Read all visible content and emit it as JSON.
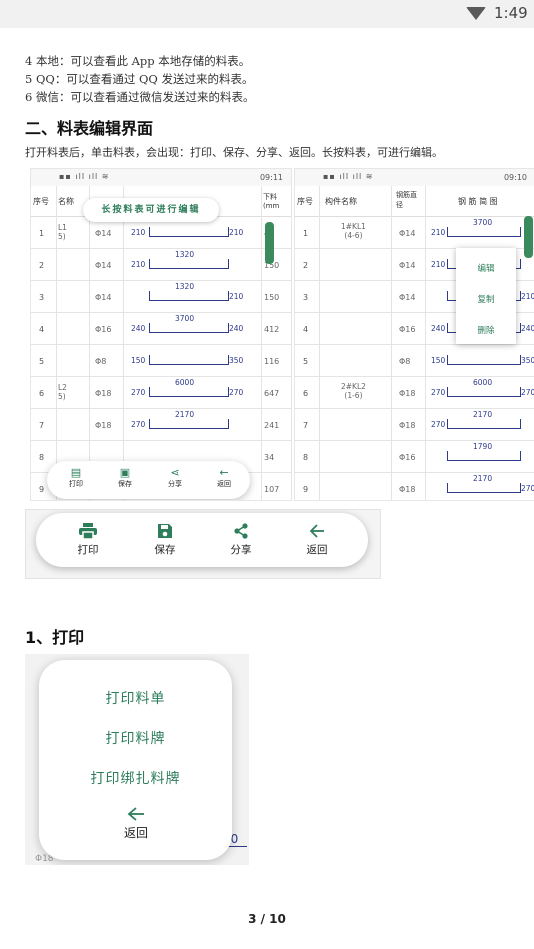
{
  "status_bar": {
    "time": "1:49"
  },
  "doc": {
    "lines": [
      "4 本地：可以查看此 App 本地存储的料表。",
      "5 QQ：可以查看通过 QQ 发送过来的料表。",
      "6 微信：可以查看通过微信发送过来的料表。"
    ],
    "section_title": "二、料表编辑界面",
    "section_desc": "打开料表后，单击料表，会出现：打印、保存、分享、返回。长按料表，可进行编辑。",
    "subsection_title": "1、打印",
    "page_number": "3  /  10"
  },
  "left_screen": {
    "status_time": "09:11",
    "headers": [
      "序号",
      "名称",
      "下料(mm"
    ],
    "tip": "长按料表可进行编辑",
    "rows": [
      {
        "n": "1",
        "name": "L1\n5)",
        "dia": "Φ14",
        "left": "210",
        "mid": "",
        "right": "210",
        "len": "4"
      },
      {
        "n": "2",
        "name": "",
        "dia": "Φ14",
        "left": "210",
        "mid": "1320",
        "right": "",
        "len": "150"
      },
      {
        "n": "3",
        "name": "",
        "dia": "Φ14",
        "left": "",
        "mid": "1320",
        "right": "210",
        "len": "150"
      },
      {
        "n": "4",
        "name": "",
        "dia": "Φ16",
        "left": "240",
        "mid": "3700",
        "right": "240",
        "len": "412"
      },
      {
        "n": "5",
        "name": "",
        "dia": "Φ8",
        "left": "150",
        "mid": "",
        "right": "350",
        "len": "116"
      },
      {
        "n": "6",
        "name": "L2\n5)",
        "dia": "Φ18",
        "left": "270",
        "mid": "6000",
        "right": "270",
        "len": "647"
      },
      {
        "n": "7",
        "name": "",
        "dia": "Φ18",
        "left": "270",
        "mid": "2170",
        "right": "",
        "len": "241"
      },
      {
        "n": "8",
        "name": "",
        "dia": "",
        "left": "",
        "mid": "",
        "right": "",
        "len": "34"
      },
      {
        "n": "9",
        "name": "",
        "dia": "",
        "left": "",
        "mid": "",
        "right": "",
        "len": "107"
      }
    ],
    "mini_actions": [
      "打印",
      "保存",
      "分享",
      "返回"
    ]
  },
  "right_screen": {
    "status_time": "09:10",
    "headers": [
      "序号",
      "构件名称",
      "钢筋直径",
      "钢 筋 简 图"
    ],
    "rows": [
      {
        "n": "1",
        "name": "1#KL1\n(4-6)",
        "dia": "Φ14",
        "left": "210",
        "mid": "3700",
        "right": ""
      },
      {
        "n": "2",
        "name": "",
        "dia": "Φ14",
        "left": "210",
        "mid": "",
        "right": ""
      },
      {
        "n": "3",
        "name": "",
        "dia": "Φ14",
        "left": "",
        "mid": "",
        "right": "210"
      },
      {
        "n": "4",
        "name": "",
        "dia": "Φ16",
        "left": "240",
        "mid": "",
        "right": "240"
      },
      {
        "n": "5",
        "name": "",
        "dia": "Φ8",
        "left": "150",
        "mid": "",
        "right": "350"
      },
      {
        "n": "6",
        "name": "2#KL2\n(1-6)",
        "dia": "Φ18",
        "left": "270",
        "mid": "6000",
        "right": "270"
      },
      {
        "n": "7",
        "name": "",
        "dia": "Φ18",
        "left": "270",
        "mid": "2170",
        "right": ""
      },
      {
        "n": "8",
        "name": "",
        "dia": "Φ16",
        "left": "",
        "mid": "1790",
        "right": ""
      },
      {
        "n": "9",
        "name": "",
        "dia": "Φ18",
        "left": "",
        "mid": "2170",
        "right": "270"
      }
    ],
    "context_menu": [
      "编辑",
      "复制",
      "删除"
    ]
  },
  "action_bar": {
    "print": "打印",
    "save": "保存",
    "share": "分享",
    "back": "返回"
  },
  "print_menu": {
    "items": [
      "打印料单",
      "打印料牌",
      "打印绑扎料牌"
    ],
    "back": "返回",
    "bg_fragment_1": "Φ18",
    "bg_fragment_2": "50"
  },
  "colors": {
    "accent": "#2e7d5b",
    "rebar": "#2d3a8c"
  }
}
